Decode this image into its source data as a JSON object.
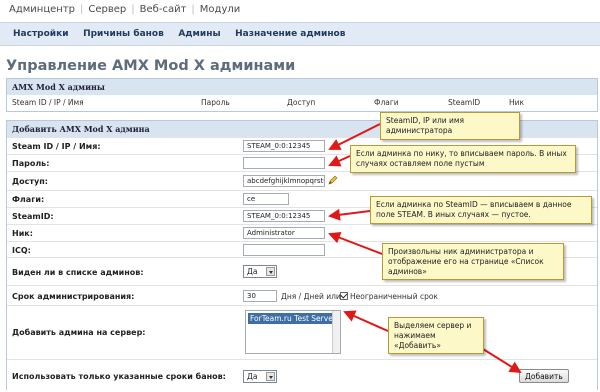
{
  "topnav": [
    "Админцентр",
    "Сервер",
    "Веб-сайт",
    "Модули"
  ],
  "subnav": [
    "Настройки",
    "Причины банов",
    "Админы",
    "Назначение админов"
  ],
  "page_title": "Управление AMX Mod X админами",
  "admins_table": {
    "caption": "AMX Mod X админы",
    "columns": [
      "Steam ID / IP / Имя",
      "Пароль",
      "Доступ",
      "Флаги",
      "SteamID",
      "Ник"
    ]
  },
  "form": {
    "caption": "Добавить AMX Mod X админа",
    "steam_label": "Steam ID / IP / Имя:",
    "steam_value": "STEAM_0:0:12345",
    "password_label": "Пароль:",
    "password_value": "",
    "access_label": "Доступ:",
    "access_value": "abcdefghijklmnopqrstu",
    "flags_label": "Флаги:",
    "flags_value": "ce",
    "steamid_label": "SteamID:",
    "steamid_value": "STEAM_0:0:12345",
    "nick_label": "Ник:",
    "nick_value": "Administrator",
    "icq_label": "ICQ:",
    "icq_value": "",
    "visible_label": "Виден ли в списке админов:",
    "visible_value": "Да",
    "term_label": "Срок администрирования:",
    "term_value": "30",
    "term_unit": "Дня / Дней или",
    "unlimited_label": "Неограниченный срок",
    "server_label": "Добавить админа на сервер:",
    "server_option": "ForTeam.ru Test Server",
    "only_terms_label": "Использовать только указанные сроки банов:",
    "only_terms_value": "Да",
    "submit_label": "Добавить"
  },
  "callouts": {
    "steam": "SteamID, IP или имя администратора",
    "password": "Если админка по нику, то вписываем пароль. В иных случаях оставляем поле пустым",
    "steamid": "Если админка по SteamID — вписываем в данное поле STEAM. В иных случаях — пустое.",
    "nick": "Произвольны ник администратора и отображение его на странице «Список админов»",
    "server": "Выделяем сервер и нажимаем «Добавить»"
  },
  "colors": {
    "callout_bg": "#fdf8c8",
    "arrow": "#e01818",
    "header_bg": "#d9e4f1",
    "subnav_bg": "#e2ebf5"
  }
}
